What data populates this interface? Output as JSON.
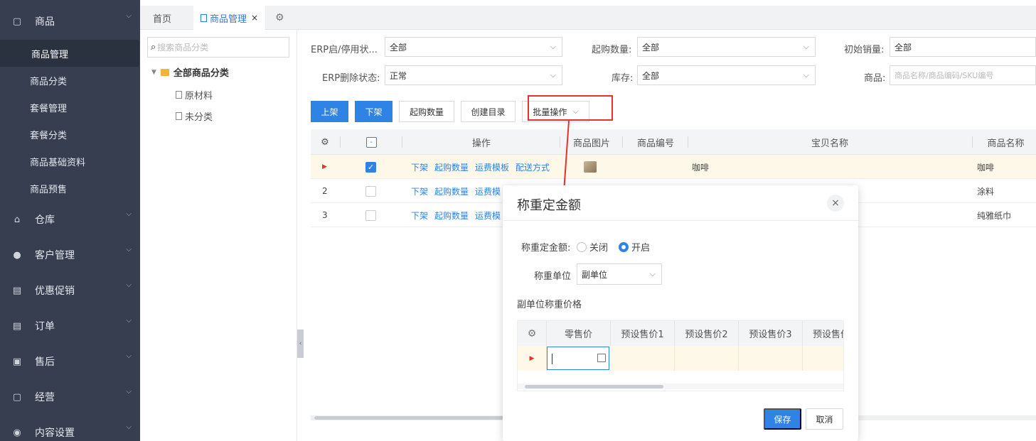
{
  "sidebar": {
    "groups": [
      {
        "label": "商品",
        "icon": "box-icon"
      },
      {
        "label": "仓库",
        "icon": "warehouse-icon"
      },
      {
        "label": "客户管理",
        "icon": "user-icon"
      },
      {
        "label": "优惠促销",
        "icon": "list-icon"
      },
      {
        "label": "订单",
        "icon": "list-icon"
      },
      {
        "label": "售后",
        "icon": "clipboard-icon"
      },
      {
        "label": "经营",
        "icon": "box-icon"
      },
      {
        "label": "内容设置",
        "icon": "eye-icon"
      }
    ],
    "sub_items": [
      "商品管理",
      "商品分类",
      "套餐管理",
      "套餐分类",
      "商品基础资料",
      "商品预售"
    ]
  },
  "tabs": {
    "home": "首页",
    "active": "商品管理",
    "close": "×"
  },
  "category": {
    "search_placeholder": "搜索商品分类",
    "root": "全部商品分类",
    "leaves": [
      "原材料",
      "未分类"
    ]
  },
  "filters": {
    "erp_status_label": "ERP启/停用状...",
    "erp_status_value": "全部",
    "min_qty_label": "起购数量:",
    "min_qty_value": "全部",
    "initial_sales_label": "初始销量:",
    "initial_sales_value": "全部",
    "erp_delete_label": "ERP删除状态:",
    "erp_delete_value": "正常",
    "stock_label": "库存:",
    "stock_value": "全部",
    "product_label": "商品:",
    "product_placeholder": "商品名称/商品编码/SKU编号"
  },
  "toolbar": {
    "on_shelf": "上架",
    "off_shelf": "下架",
    "min_qty": "起购数量",
    "create_catalog": "创建目录",
    "batch": "批量操作"
  },
  "grid": {
    "headers": {
      "action": "操作",
      "image": "商品图片",
      "code": "商品编号",
      "title": "宝贝名称",
      "name": "商品名称"
    },
    "row_actions": [
      "下架",
      "起购数量",
      "运费模板",
      "配送方式"
    ],
    "row_actions_truncated": [
      "下架",
      "起购数量",
      "运费模"
    ],
    "rows": [
      {
        "index": "",
        "title": "咖啡",
        "name": "咖啡"
      },
      {
        "index": "2",
        "title": "",
        "name": "涂料"
      },
      {
        "index": "3",
        "title": "",
        "name": "纯雅纸巾"
      }
    ]
  },
  "modal": {
    "title": "称重定金额",
    "close": "×",
    "weigh_label": "称重定金额:",
    "option_off": "关闭",
    "option_on": "开启",
    "unit_label": "称重单位",
    "unit_value": "副单位",
    "price_section": "副单位称重价格",
    "price_headers": [
      "零售价",
      "预设售价1",
      "预设售价2",
      "预设售价3",
      "预设售价"
    ],
    "save": "保存",
    "cancel": "取消"
  },
  "colors": {
    "accent": "#2f83e4",
    "sidebar_bg": "#363e4f",
    "annotation": "#e5322d"
  }
}
